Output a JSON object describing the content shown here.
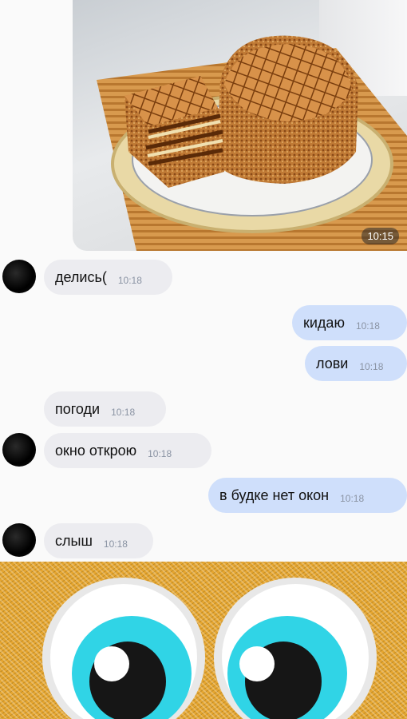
{
  "photo_message": {
    "time": "10:15"
  },
  "messages": [
    {
      "dir": "in",
      "text": "делись(",
      "time": "10:18"
    },
    {
      "dir": "out",
      "text": "кидаю",
      "time": "10:18"
    },
    {
      "dir": "out",
      "text": "лови",
      "time": "10:18"
    },
    {
      "dir": "in",
      "text": "погоди",
      "time": "10:18"
    },
    {
      "dir": "in",
      "text": "окно открою",
      "time": "10:18"
    },
    {
      "dir": "out",
      "text": "в будке нет окон",
      "time": "10:18"
    },
    {
      "dir": "in",
      "text": "слыш",
      "time": "10:18"
    }
  ],
  "colors": {
    "incoming_bubble": "#ececf0",
    "outgoing_bubble": "#cfdffb",
    "timestamp": "#8a93a3"
  }
}
